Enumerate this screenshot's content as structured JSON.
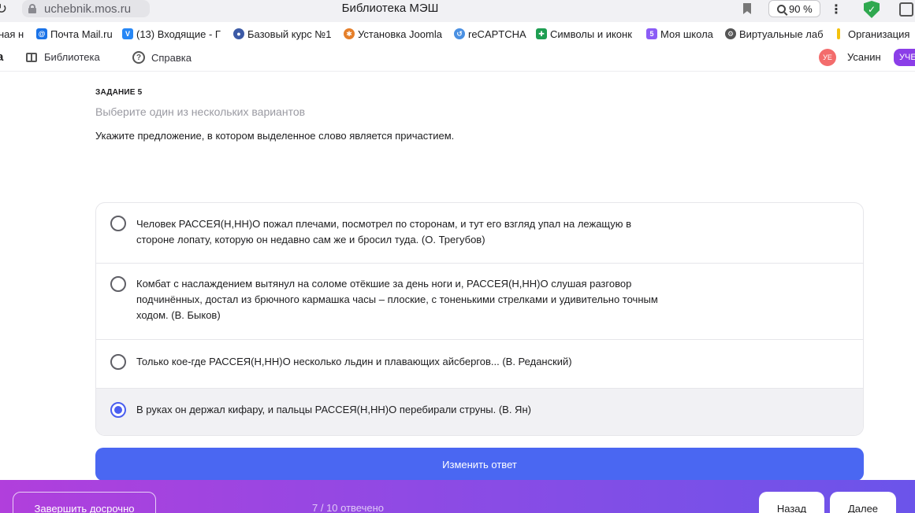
{
  "browser": {
    "url": "uchebnik.mos.ru",
    "page_title": "Библиотека МЭШ",
    "zoom": "90 %",
    "bookmarks": [
      {
        "label": "ная н",
        "icon": "none",
        "color": ""
      },
      {
        "label": "Почта Mail.ru",
        "icon": "mail-icon",
        "color": "#1a73e8"
      },
      {
        "label": "(13) Входящие - Г",
        "icon": "vk-icon",
        "color": "#2787f5"
      },
      {
        "label": "Базовый курс №1",
        "icon": "course-icon",
        "color": "#3c5aa6"
      },
      {
        "label": "Установка Joomla",
        "icon": "joomla-icon",
        "color": "#e57f2a"
      },
      {
        "label": "reCAPTCHA",
        "icon": "recaptcha-icon",
        "color": "#4a90e2"
      },
      {
        "label": "Символы и иконк",
        "icon": "symbols-icon",
        "color": "#1e9e52"
      },
      {
        "label": "Моя школа",
        "icon": "school-icon",
        "color": "#8b5cf6"
      },
      {
        "label": "Виртуальные лаб",
        "icon": "lab-icon",
        "color": "#555555"
      },
      {
        "label": "Организация",
        "icon": "org-icon",
        "color": "#f4c20d"
      }
    ]
  },
  "header": {
    "brand_fragment": "а",
    "library": "Библиотека",
    "help": "Справка",
    "user_initials": "УЕ",
    "user_name": "Усанин",
    "role_badge": "УЧЕ"
  },
  "task": {
    "label": "ЗАДАНИЕ 5",
    "hint": "Выберите один из нескольких вариантов",
    "question": "Укажите предложение, в котором выделенное слово является причастием.",
    "options": [
      {
        "text": "Человек РАССЕЯ(Н,НН)О пожал плечами, посмотрел по сторонам, и тут его взгляд упал на лежащую в стороне лопату, которую он недавно сам же и бросил туда. (О. Трегубов)",
        "selected": false
      },
      {
        "text": "Комбат с наслаждением вытянул на соломе отёкшие за день ноги и, РАССЕЯ(Н,НН)О слушая разговор подчинённых, достал из брючного кармашка часы – плоские, с тоненькими стрелками и удивительно точным ходом. (В. Быков)",
        "selected": false
      },
      {
        "text": "Только кое-где РАССЕЯ(Н,НН)О несколько льдин и плавающих айсбергов... (В. Реданский)",
        "selected": false
      },
      {
        "text": "В руках он держал кифару, и пальцы РАССЕЯ(Н,НН)О перебирали струны. (В. Ян)",
        "selected": true
      }
    ],
    "change_answer": "Изменить ответ"
  },
  "footer": {
    "finish": "Завершить досрочно",
    "progress": "7 / 10 отвечено",
    "back": "Назад",
    "next": "Далее"
  },
  "colors": {
    "accent": "#4a67f2",
    "footer_start": "#b13fdc",
    "footer_end": "#6b54ea"
  }
}
